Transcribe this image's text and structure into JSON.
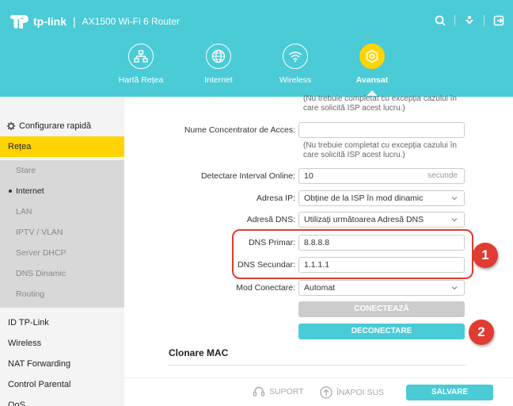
{
  "header": {
    "brand": "tp-link",
    "separator": "|",
    "model": "AX1500 Wi-Fi 6 Router",
    "icons": [
      "search-icon",
      "download-icon",
      "logout-icon"
    ],
    "nav": [
      {
        "label": "Hartă Rețea",
        "icon": "network-map-icon",
        "active": false
      },
      {
        "label": "Internet",
        "icon": "globe-icon",
        "active": false
      },
      {
        "label": "Wireless",
        "icon": "wifi-icon",
        "active": false
      },
      {
        "label": "Avansat",
        "icon": "gear-icon",
        "active": true
      }
    ],
    "accent": "#4acbd6",
    "active_color": "#ffd400"
  },
  "sidebar": {
    "quick_setup": "Configurare rapidă",
    "network": "Rețea",
    "sub_items": [
      "Stare",
      "Internet",
      "LAN",
      "IPTV / VLAN",
      "Server DHCP",
      "DNS Dinamic",
      "Routing"
    ],
    "active_sub": "Internet",
    "items": [
      "ID TP-Link",
      "Wireless",
      "NAT Forwarding",
      "Control Parental",
      "QoS"
    ]
  },
  "form": {
    "top_hint": "(Nu trebuie completat cu excepția cazului în care solicită ISP acest lucru.)",
    "concentrator_label": "Nume Concentrator de Acces:",
    "concentrator_value": "",
    "concentrator_hint": "(Nu trebuie completat cu excepția cazului în care solicită ISP acest lucru.)",
    "interval_label": "Detectare Interval Online:",
    "interval_value": "10",
    "interval_unit": "secunde",
    "ip_label": "Adresa IP:",
    "ip_value": "Obține de la ISP în mod dinamic",
    "dns_mode_label": "Adresă DNS:",
    "dns_mode_value": "Utilizați următoarea Adresă DNS",
    "dns_primary_label": "DNS Primar:",
    "dns_primary_value": "8.8.8.8",
    "dns_secondary_label": "DNS Secundar:",
    "dns_secondary_value": "1.1.1.1",
    "conn_mode_label": "Mod Conectare:",
    "conn_mode_value": "Automat",
    "connect_button": "CONECTEAZĂ",
    "disconnect_button": "DECONECTARE",
    "mac_clone_title": "Clonare MAC"
  },
  "annotations": {
    "badge1": "1",
    "badge2": "2",
    "color": "#e03c32"
  },
  "footer": {
    "support": "SUPORT",
    "back_top": "ÎNAPOI SUS",
    "save": "SALVARE"
  }
}
